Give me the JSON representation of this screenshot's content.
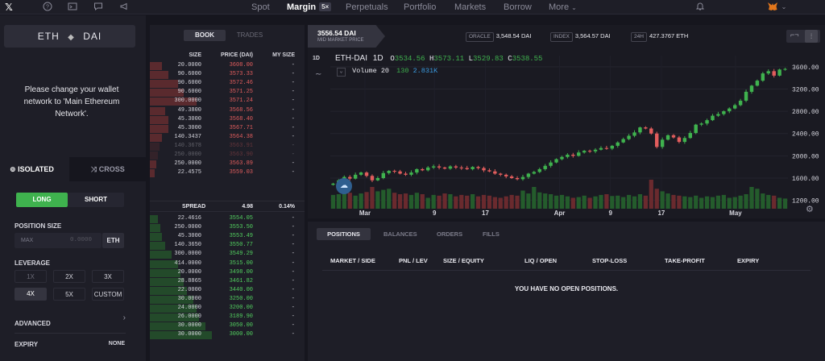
{
  "topbar": {
    "nav": [
      {
        "label": "Spot",
        "active": false
      },
      {
        "label": "Margin",
        "active": true,
        "badge": "5×"
      },
      {
        "label": "Perpetuals",
        "active": false
      },
      {
        "label": "Portfolio",
        "active": false
      },
      {
        "label": "Markets",
        "active": false
      },
      {
        "label": "Borrow",
        "active": false
      },
      {
        "label": "More",
        "active": false
      }
    ]
  },
  "left": {
    "pair_base": "ETH",
    "pair_quote": "DAI",
    "message": "Please change your wallet network to 'Main Ethereum Network'.",
    "tab_isolated": "ISOLATED",
    "tab_cross": "CROSS",
    "long": "LONG",
    "short": "SHORT",
    "position_size_label": "POSITION SIZE",
    "max_label": "MAX",
    "size_placeholder": "0.0000",
    "size_unit": "ETH",
    "leverage_label": "LEVERAGE",
    "leverage_options": [
      "1X",
      "2X",
      "3X",
      "4X",
      "5X",
      "CUSTOM"
    ],
    "leverage_selected": "4X",
    "advanced_label": "ADVANCED",
    "expiry_label": "EXPIRY",
    "expiry_value": "NONE"
  },
  "orderbook": {
    "tab_book": "BOOK",
    "tab_trades": "TRADES",
    "col_size": "SIZE",
    "col_price": "PRICE (DAI)",
    "col_my": "MY SIZE",
    "asks": [
      {
        "size": "20.0000",
        "price": "3608.00",
        "my": "-",
        "depth": 0.08
      },
      {
        "size": "90.6000",
        "price": "3573.33",
        "my": "-",
        "depth": 0.12
      },
      {
        "size": "90.6000",
        "price": "3572.46",
        "my": "-",
        "depth": 0.18
      },
      {
        "size": "90.6000",
        "price": "3571.25",
        "my": "-",
        "depth": 0.22
      },
      {
        "size": "300.0000",
        "price": "3571.24",
        "my": "-",
        "depth": 0.3
      },
      {
        "size": "49.3800",
        "price": "3568.56",
        "my": "-",
        "depth": 0.1
      },
      {
        "size": "45.3000",
        "price": "3568.40",
        "my": "-",
        "depth": 0.12
      },
      {
        "size": "45.3000",
        "price": "3567.71",
        "my": "-",
        "depth": 0.12
      },
      {
        "size": "140.3437",
        "price": "3564.38",
        "my": "-",
        "depth": 0.08
      },
      {
        "size": "140.3678",
        "price": "3563.91",
        "my": "-",
        "depth": 0.06
      },
      {
        "size": "250.0000",
        "price": "3563.90",
        "my": "-",
        "depth": 0.05
      },
      {
        "size": "250.0000",
        "price": "3563.89",
        "my": "-",
        "depth": 0.04
      },
      {
        "size": "22.4575",
        "price": "3559.03",
        "my": "-",
        "depth": 0.03
      }
    ],
    "spread_label": "SPREAD",
    "spread_value": "4.98",
    "spread_pct": "0.14%",
    "bids": [
      {
        "size": "22.4616",
        "price": "3554.05",
        "my": "-",
        "depth": 0.05
      },
      {
        "size": "250.0000",
        "price": "3553.50",
        "my": "-",
        "depth": 0.07
      },
      {
        "size": "45.3000",
        "price": "3553.49",
        "my": "-",
        "depth": 0.08
      },
      {
        "size": "140.3650",
        "price": "3550.77",
        "my": "-",
        "depth": 0.1
      },
      {
        "size": "300.0000",
        "price": "3549.29",
        "my": "-",
        "depth": 0.14
      },
      {
        "size": "414.0000",
        "price": "3515.00",
        "my": "-",
        "depth": 0.18
      },
      {
        "size": "20.0000",
        "price": "3498.00",
        "my": "-",
        "depth": 0.2
      },
      {
        "size": "28.8865",
        "price": "3461.82",
        "my": "-",
        "depth": 0.22
      },
      {
        "size": "22.0000",
        "price": "3440.00",
        "my": "-",
        "depth": 0.24
      },
      {
        "size": "30.0000",
        "price": "3250.00",
        "my": "-",
        "depth": 0.28
      },
      {
        "size": "24.0000",
        "price": "3200.00",
        "my": "-",
        "depth": 0.3
      },
      {
        "size": "26.0000",
        "price": "3189.90",
        "my": "-",
        "depth": 0.32
      },
      {
        "size": "30.0000",
        "price": "3050.00",
        "my": "-",
        "depth": 0.36
      },
      {
        "size": "30.0000",
        "price": "3000.00",
        "my": "-",
        "depth": 0.4
      }
    ]
  },
  "market": {
    "mid_price": "3556.54 DAI",
    "mid_label": "MID MARKET PRICE",
    "oracle_label": "ORACLE",
    "oracle_value": "3,548.54 DAI",
    "index_label": "INDEX",
    "index_value": "3,564.57 DAI",
    "h24_label": "24H",
    "h24_value": "427.3767 ETH"
  },
  "chart_data": {
    "type": "candlestick",
    "symbol": "ETH-DAI",
    "interval": "1D",
    "interval_button": "1D",
    "ohlc": {
      "o": "3534.56",
      "h": "3573.11",
      "l": "3529.83",
      "c": "3538.55"
    },
    "volume_label": "Volume",
    "volume_period": "20",
    "volume_value": "130",
    "volume_ma": "2.831K",
    "y_ticks": [
      "3600.00",
      "3200.00",
      "2800.00",
      "2400.00",
      "2000.00",
      "1600.00",
      "1200.00"
    ],
    "ylim": [
      1050,
      3800
    ],
    "x_ticks": [
      "Mar",
      "9",
      "17",
      "Apr",
      "9",
      "17",
      "May"
    ],
    "close": [
      1500,
      1560,
      1620,
      1590,
      1660,
      1700,
      1640,
      1560,
      1600,
      1690,
      1730,
      1720,
      1680,
      1660,
      1700,
      1760,
      1740,
      1790,
      1810,
      1790,
      1770,
      1810,
      1790,
      1780,
      1760,
      1800,
      1780,
      1740,
      1720,
      1680,
      1660,
      1630,
      1600,
      1580,
      1620,
      1680,
      1710,
      1760,
      1820,
      1880,
      1940,
      1980,
      2020,
      2000,
      2060,
      2090,
      2080,
      2110,
      2140,
      2130,
      2180,
      2240,
      2300,
      2360,
      2420,
      2510,
      2490,
      2400,
      2160,
      2290,
      2370,
      2330,
      2250,
      2320,
      2410,
      2560,
      2580,
      2640,
      2720,
      2750,
      2800,
      2850,
      2910,
      2990,
      3150,
      3260,
      3350,
      3480,
      3520,
      3440,
      3550,
      3560
    ],
    "volume": [
      38,
      40,
      50,
      44,
      36,
      42,
      46,
      60,
      48,
      52,
      55,
      44,
      40,
      42,
      38,
      44,
      40,
      30,
      38,
      36,
      42,
      40,
      34,
      38,
      36,
      40,
      34,
      38,
      36,
      32,
      30,
      34,
      38,
      36,
      50,
      42,
      60,
      45,
      42,
      40,
      36,
      38,
      34,
      30,
      32,
      36,
      30,
      34,
      38,
      40,
      35,
      36,
      32,
      38,
      34,
      40,
      36,
      80,
      55,
      48,
      42,
      38,
      36,
      34,
      32,
      36,
      30,
      34,
      32,
      36,
      38,
      30,
      32,
      36,
      40,
      60,
      55,
      42,
      38,
      36,
      30,
      28
    ]
  },
  "positions": {
    "tabs": [
      "POSITIONS",
      "BALANCES",
      "ORDERS",
      "FILLS"
    ],
    "active_tab": "POSITIONS",
    "columns": [
      "MARKET / SIDE",
      "PNL / LEV",
      "SIZE / EQUITY",
      "LIQ / OPEN",
      "STOP-LOSS",
      "TAKE-PROFIT",
      "EXPIRY"
    ],
    "empty": "YOU HAVE NO OPEN POSITIONS."
  }
}
